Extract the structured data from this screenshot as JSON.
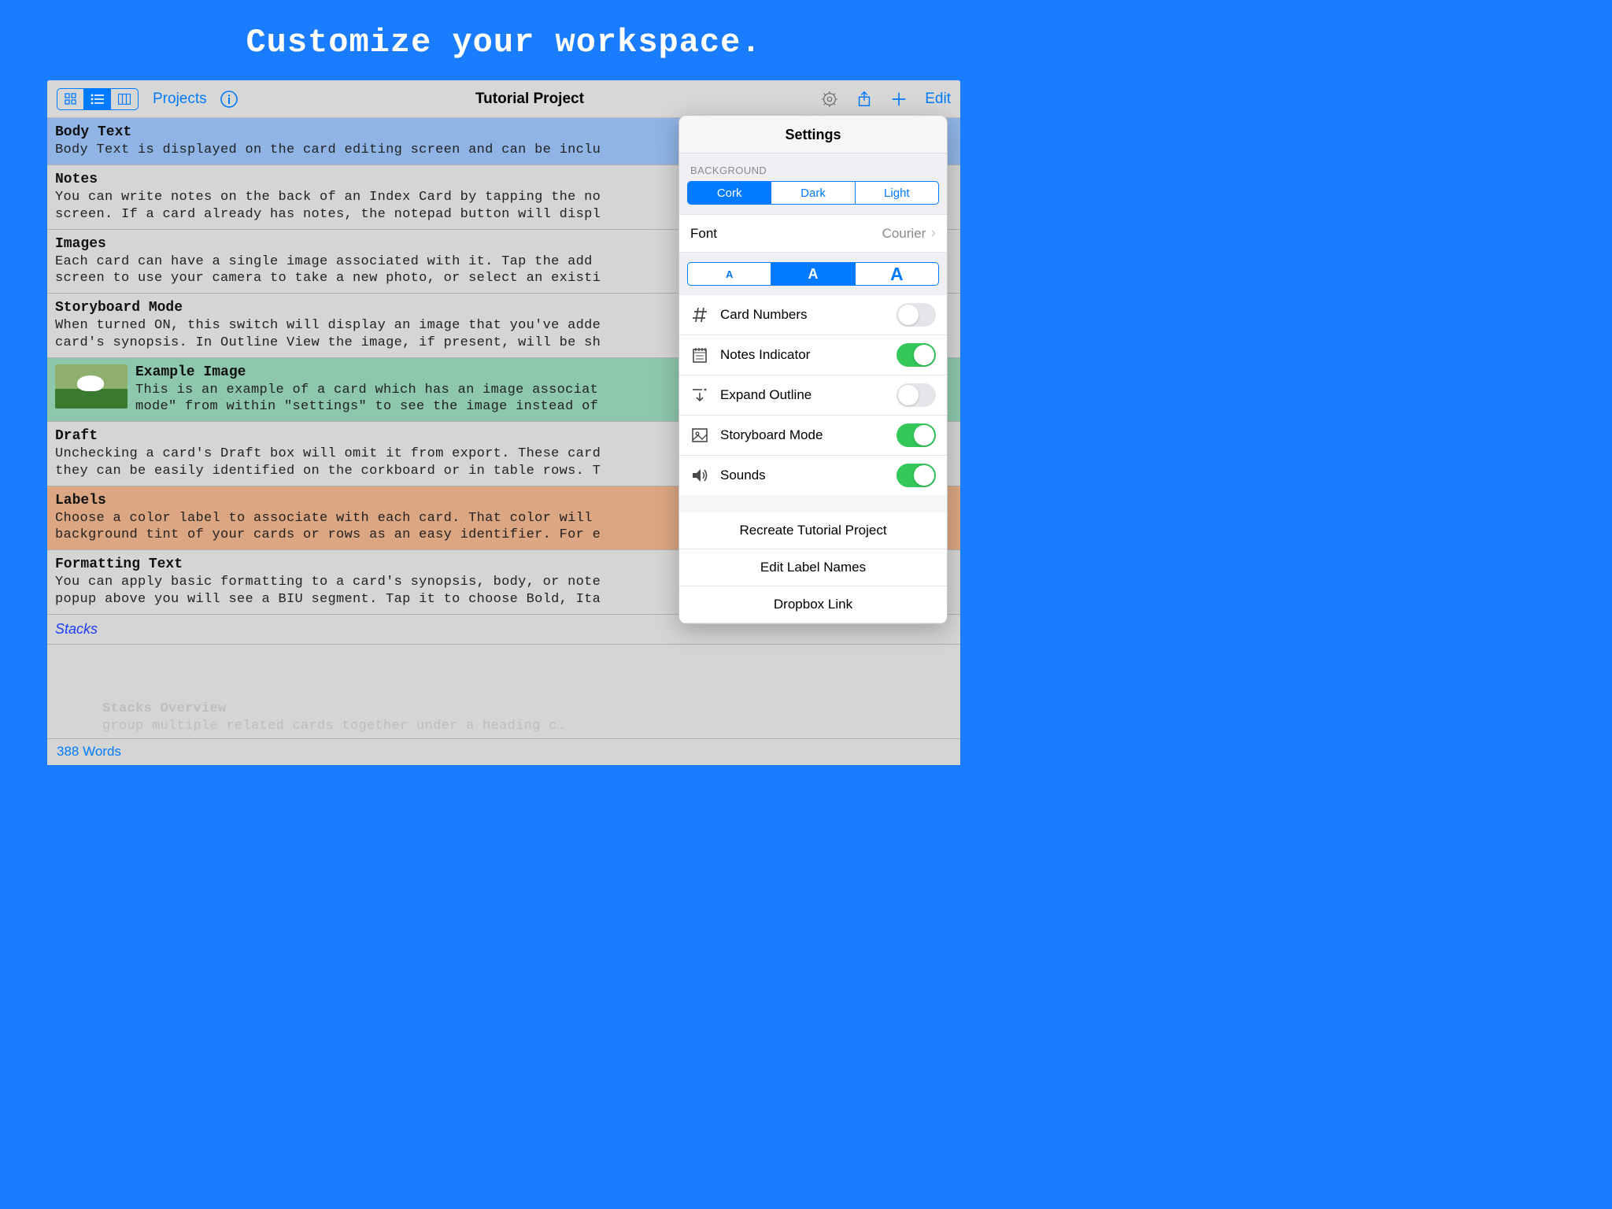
{
  "banner": "Customize your workspace.",
  "toolbar": {
    "projects": "Projects",
    "title": "Tutorial Project",
    "edit": "Edit"
  },
  "rows": [
    {
      "title": "Body Text",
      "body": "Body Text is displayed on the card editing screen and can be inclu"
    },
    {
      "title": "Notes",
      "body": "You can write notes on the back of an Index Card by tapping the no                      ig\nscreen. If a card already has notes, the notepad button will displ                       …"
    },
    {
      "title": "Images",
      "body": "Each card can have a single image associated with it. Tap the add                       ig\nscreen to use your camera to take a new photo, or select an existi                       i."
    },
    {
      "title": "Storyboard Mode",
      "body": "When turned ON, this switch will display an image that you've adde\ncard's synopsis. In Outline View the image, if present, will be sh                       …"
    },
    {
      "title": "Example Image",
      "body": "This is an example of a card which has an image associat            rd\nmode\" from within \"settings\" to see the image instead of             …"
    },
    {
      "title": "Draft",
      "body": "Unchecking a card's Draft box will omit it from export. These card\nthey can be easily identified on the corkboard or in table rows. T                       …"
    },
    {
      "title": "Labels",
      "body": "Choose a color label to associate with each card. That color will\nbackground tint of your cards or rows as an easy identifier. For e                       …"
    },
    {
      "title": "Formatting Text",
      "body": "You can apply basic formatting to a card's synopsis, body, or note                       ie\npopup above you will see a BIU segment. Tap it to choose Bold, Ita                       …"
    }
  ],
  "stack_label": "Stacks",
  "ghost": {
    "l1": "Stacks Overview",
    "l2": "group multiple related cards together under a heading c…",
    "l3": ""
  },
  "footer": {
    "words": "388 Words"
  },
  "settings": {
    "title": "Settings",
    "bg_label": "BACKGROUND",
    "bg_options": [
      "Cork",
      "Dark",
      "Light"
    ],
    "font_label": "Font",
    "font_value": "Courier",
    "toggles": [
      {
        "label": "Card Numbers",
        "on": false,
        "icon": "hash"
      },
      {
        "label": "Notes Indicator",
        "on": true,
        "icon": "notepad"
      },
      {
        "label": "Expand Outline",
        "on": false,
        "icon": "expand"
      },
      {
        "label": "Storyboard Mode",
        "on": true,
        "icon": "picture"
      },
      {
        "label": "Sounds",
        "on": true,
        "icon": "speaker"
      }
    ],
    "actions": [
      "Recreate Tutorial Project",
      "Edit Label Names",
      "Dropbox Link"
    ]
  }
}
